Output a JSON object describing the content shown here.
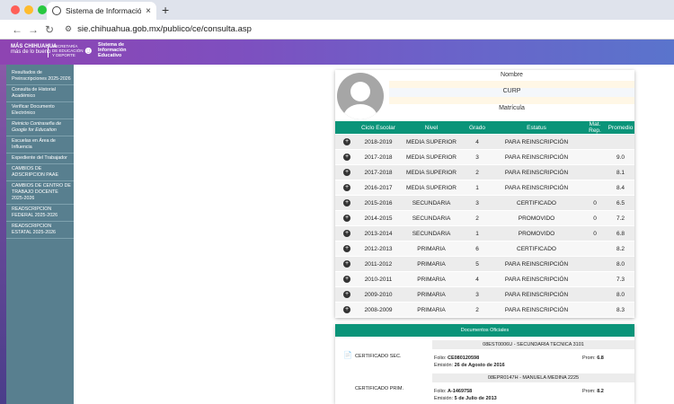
{
  "browser": {
    "tab_title": "Sistema de Información Educ",
    "url": "sie.chihuahua.gob.mx/publico/ce/consulta.asp",
    "colors": {
      "close": "#ff5f57",
      "min": "#febc2e",
      "max": "#28c840"
    }
  },
  "header": {
    "logo_left": [
      "MÁS CHIHUAHUA",
      "más de lo bueno"
    ],
    "logo_mid": [
      "SECRETARÍA",
      "DE EDUCACIÓN",
      "Y DEPORTE"
    ],
    "logo_right": [
      "Sistema de",
      "Información",
      "Educativo"
    ]
  },
  "sidebar": {
    "items": [
      {
        "label": "Resultados de Preinscripciones 2025-2026"
      },
      {
        "label": "Consulta de Historial Académico"
      },
      {
        "label": "Verificar Documento Electrónico"
      },
      {
        "label": "Reinicio Contraseña de Google for Education"
      },
      {
        "label": "Escuelas en Área de Influencia"
      },
      {
        "label": "Expediente del Trabajador"
      },
      {
        "label": "CAMBIOS DE ADSCRIPCION PAAE"
      },
      {
        "label": "CAMBIOS DE CENTRO DE TRABAJO DOCENTE 2025-2026"
      },
      {
        "label": "READSCRIPCION FEDERAL 2025-2026"
      },
      {
        "label": "READSCRIPCION ESTATAL 2025-2026"
      }
    ]
  },
  "profile": {
    "nombre_label": "Nombre",
    "curp_label": "CURP",
    "matricula_label": "Matrícula"
  },
  "table": {
    "headers": [
      "Ciclo Escolar",
      "Nivel",
      "Grado",
      "Estatus",
      "Mat. Rep.",
      "Promedio"
    ],
    "rows": [
      {
        "ciclo": "2018-2019",
        "nivel": "MEDIA SUPERIOR",
        "grado": "4",
        "estatus": "PARA REINSCRIPCIÓN",
        "mat": "",
        "prom": ""
      },
      {
        "ciclo": "2017-2018",
        "nivel": "MEDIA SUPERIOR",
        "grado": "3",
        "estatus": "PARA REINSCRIPCIÓN",
        "mat": "",
        "prom": "9.0"
      },
      {
        "ciclo": "2017-2018",
        "nivel": "MEDIA SUPERIOR",
        "grado": "2",
        "estatus": "PARA REINSCRIPCIÓN",
        "mat": "",
        "prom": "8.1"
      },
      {
        "ciclo": "2016-2017",
        "nivel": "MEDIA SUPERIOR",
        "grado": "1",
        "estatus": "PARA REINSCRIPCIÓN",
        "mat": "",
        "prom": "8.4"
      },
      {
        "ciclo": "2015-2016",
        "nivel": "SECUNDARIA",
        "grado": "3",
        "estatus": "CERTIFICADO",
        "mat": "0",
        "prom": "6.5"
      },
      {
        "ciclo": "2014-2015",
        "nivel": "SECUNDARIA",
        "grado": "2",
        "estatus": "PROMOVIDO",
        "mat": "0",
        "prom": "7.2"
      },
      {
        "ciclo": "2013-2014",
        "nivel": "SECUNDARIA",
        "grado": "1",
        "estatus": "PROMOVIDO",
        "mat": "0",
        "prom": "6.8"
      },
      {
        "ciclo": "2012-2013",
        "nivel": "PRIMARIA",
        "grado": "6",
        "estatus": "CERTIFICADO",
        "mat": "",
        "prom": "8.2"
      },
      {
        "ciclo": "2011-2012",
        "nivel": "PRIMARIA",
        "grado": "5",
        "estatus": "PARA REINSCRIPCIÓN",
        "mat": "",
        "prom": "8.0"
      },
      {
        "ciclo": "2010-2011",
        "nivel": "PRIMARIA",
        "grado": "4",
        "estatus": "PARA REINSCRIPCIÓN",
        "mat": "",
        "prom": "7.3"
      },
      {
        "ciclo": "2009-2010",
        "nivel": "PRIMARIA",
        "grado": "3",
        "estatus": "PARA REINSCRIPCIÓN",
        "mat": "",
        "prom": "8.0"
      },
      {
        "ciclo": "2008-2009",
        "nivel": "PRIMARIA",
        "grado": "2",
        "estatus": "PARA REINSCRIPCIÓN",
        "mat": "",
        "prom": "8.3"
      }
    ]
  },
  "docs": {
    "title": "Documentos Oficiales",
    "items": [
      {
        "school": "08EST0006U - SECUNDARIA TECNICA 3101",
        "label": "CERTIFICADO SEC.",
        "folio_label": "Folio:",
        "folio": "CE080120598",
        "emision_label": "Emisión:",
        "emision": "26 de Agosto de 2016",
        "prom_label": "Prom:",
        "prom": "6.8"
      },
      {
        "school": "08EPR0147H - MANUELA MEDINA 2225",
        "label": "CERTIFICADO PRIM.",
        "folio_label": "Folio:",
        "folio": "A-1469758",
        "emision_label": "Emisión:",
        "emision": "5 de Julio de 2013",
        "prom_label": "Prom:",
        "prom": "8.2"
      }
    ]
  }
}
